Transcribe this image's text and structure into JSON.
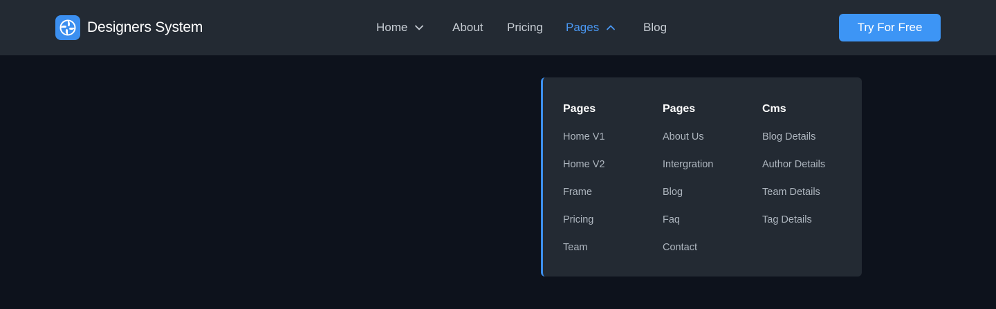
{
  "brand": {
    "name": "Designers System",
    "icon": "swirl-logo-icon"
  },
  "nav": {
    "items": [
      {
        "label": "Home",
        "icon": "chevron-down-icon"
      },
      {
        "label": "About"
      },
      {
        "label": "Pricing"
      },
      {
        "label": "Pages",
        "icon": "chevron-up-icon",
        "active": true
      },
      {
        "label": "Blog"
      }
    ],
    "cta_label": "Try For Free"
  },
  "dropdown": {
    "columns": [
      {
        "title": "Pages",
        "links": [
          "Home V1",
          "Home V2",
          "Frame",
          "Pricing",
          "Team"
        ]
      },
      {
        "title": "Pages",
        "links": [
          "About Us",
          "Intergration",
          "Blog",
          "Faq",
          "Contact"
        ]
      },
      {
        "title": "Cms",
        "links": [
          "Blog Details",
          "Author Details",
          "Team Details",
          "Tag Details"
        ]
      }
    ]
  },
  "colors": {
    "background": "#0d121c",
    "navbar": "#232a33",
    "accent": "#3d95f5",
    "active_link": "#4a99f5"
  }
}
